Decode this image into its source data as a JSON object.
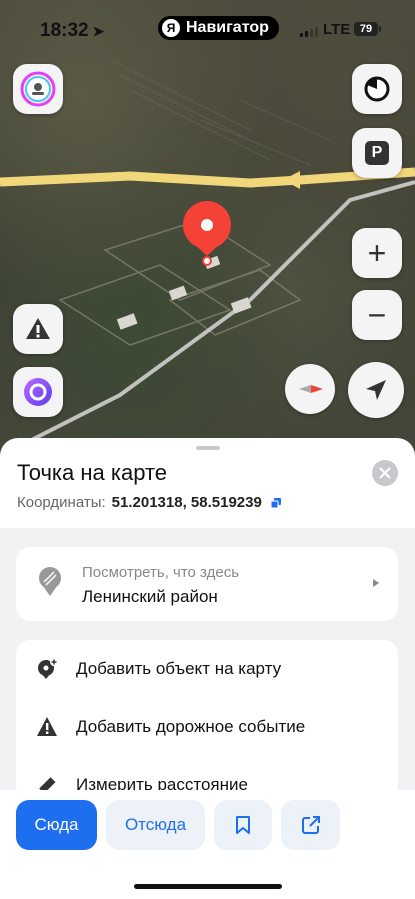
{
  "status_bar": {
    "time": "18:32",
    "app_badge": "Я",
    "app_name": "Навигатор",
    "network": "LTE",
    "battery": "79"
  },
  "map": {
    "buttons": {
      "alice_left_top": "profile",
      "layers": "layers",
      "parking": "P",
      "zoom_in": "+",
      "zoom_out": "−",
      "road_events": "!",
      "alice_assistant": "alice",
      "compass": "compass",
      "locate": "locate"
    }
  },
  "sheet": {
    "title": "Точка на карте",
    "coords_label": "Координаты:",
    "coords_value": "51.201318, 58.519239",
    "whats_here": {
      "label": "Посмотреть, что здесь",
      "value": "Ленинский район"
    },
    "menu": [
      {
        "label": "Добавить объект на карту",
        "icon": "add-place-icon"
      },
      {
        "label": "Добавить дорожное событие",
        "icon": "warning-icon"
      },
      {
        "label": "Измерить расстояние",
        "icon": "ruler-icon"
      }
    ]
  },
  "actions": {
    "here": "Сюда",
    "from": "Отсюда",
    "bookmark": "bookmark-icon",
    "share": "share-icon"
  },
  "colors": {
    "accent": "#1e6ff0",
    "pin": "#f44336",
    "route": "#f5d67a"
  }
}
